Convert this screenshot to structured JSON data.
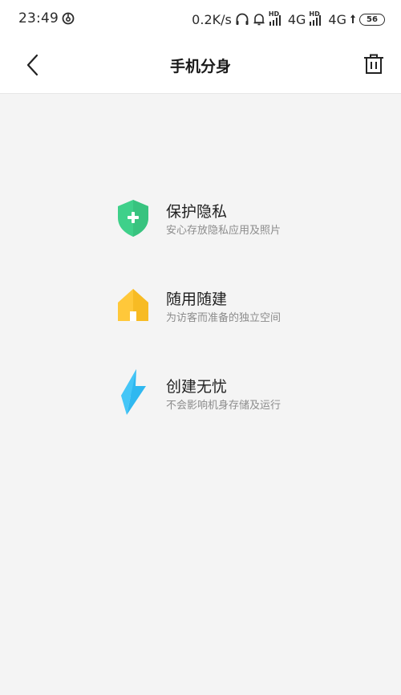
{
  "status_bar": {
    "time": "23:49",
    "net_speed": "0.2K/s",
    "network_1": "4G",
    "network_2": "4G",
    "battery": "56",
    "hd_label": "HD",
    "icons": [
      "app-notification-icon",
      "headphones-icon",
      "bell-icon",
      "signal-icon",
      "data-arrow-icon"
    ]
  },
  "nav": {
    "title": "手机分身"
  },
  "features": [
    {
      "title": "保护隐私",
      "desc": "安心存放隐私应用及照片",
      "icon": "shield-icon",
      "color": "#3fd08a"
    },
    {
      "title": "随用随建",
      "desc": "为访客而准备的独立空间",
      "icon": "house-icon",
      "color": "#ffc83a"
    },
    {
      "title": "创建无忧",
      "desc": "不会影响机身存储及运行",
      "icon": "lightning-icon",
      "color": "#2fb8f0"
    }
  ],
  "colors": {
    "background": "#f4f4f4",
    "header": "#ffffff"
  }
}
